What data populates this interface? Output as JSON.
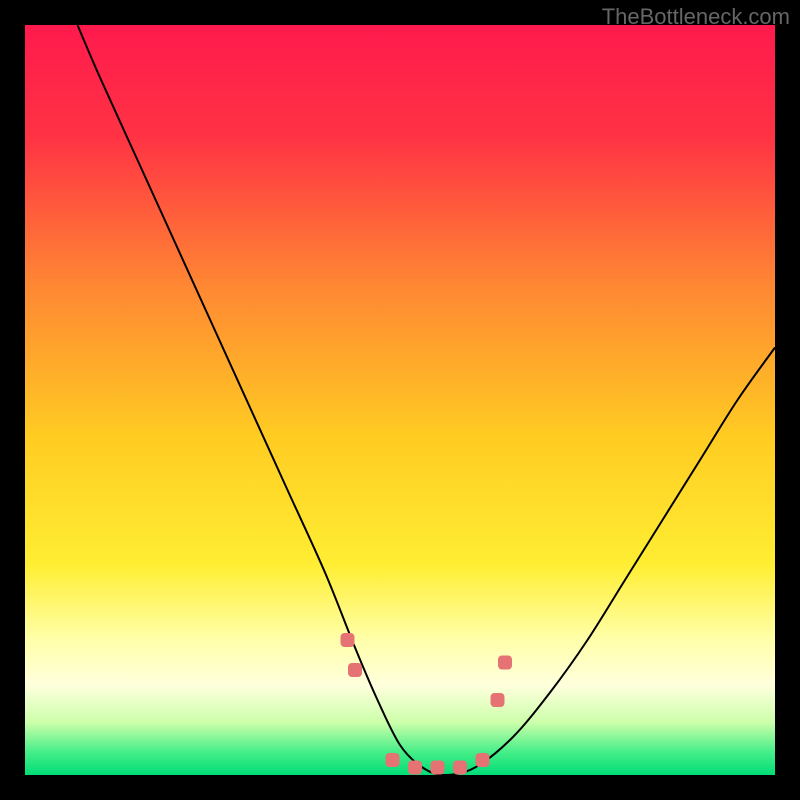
{
  "watermark": "TheBottleneck.com",
  "chart_data": {
    "type": "line",
    "title": "",
    "xlabel": "",
    "ylabel": "",
    "xlim": [
      0,
      100
    ],
    "ylim": [
      0,
      100
    ],
    "background_gradient": {
      "stops": [
        {
          "offset": 0,
          "color": "#ff1a4d"
        },
        {
          "offset": 15,
          "color": "#ff3344"
        },
        {
          "offset": 35,
          "color": "#ff8833"
        },
        {
          "offset": 55,
          "color": "#ffcc22"
        },
        {
          "offset": 72,
          "color": "#ffee33"
        },
        {
          "offset": 82,
          "color": "#ffffaa"
        },
        {
          "offset": 88,
          "color": "#ffffdd"
        },
        {
          "offset": 93,
          "color": "#ccffaa"
        },
        {
          "offset": 97,
          "color": "#44ee88"
        },
        {
          "offset": 100,
          "color": "#00dd77"
        }
      ]
    },
    "series": [
      {
        "name": "bottleneck-curve",
        "type": "line",
        "color": "#000000",
        "x": [
          7,
          10,
          15,
          20,
          25,
          30,
          35,
          40,
          44,
          47,
          50,
          53,
          56,
          60,
          65,
          70,
          75,
          80,
          85,
          90,
          95,
          100
        ],
        "values": [
          100,
          93,
          82,
          71,
          60,
          49,
          38,
          27,
          17,
          10,
          4,
          1,
          0,
          1,
          5,
          11,
          18,
          26,
          34,
          42,
          50,
          57
        ]
      },
      {
        "name": "markers",
        "type": "scatter",
        "color": "#e57373",
        "x": [
          43,
          44,
          49,
          52,
          55,
          58,
          61,
          63,
          64
        ],
        "values": [
          18,
          14,
          2,
          1,
          1,
          1,
          2,
          10,
          15
        ]
      }
    ]
  }
}
